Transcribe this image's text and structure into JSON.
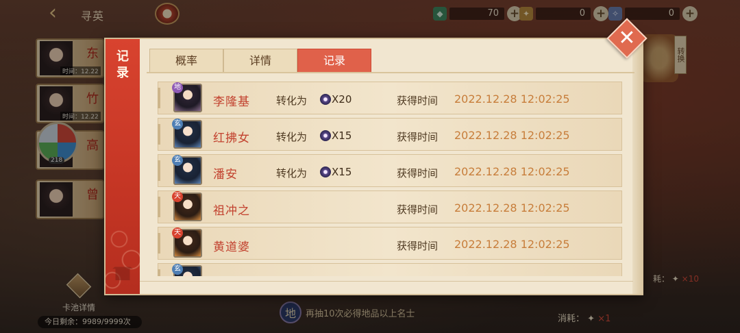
{
  "topbar": {
    "back_icon": "chevron-left-icon",
    "title": "寻英",
    "currencies": [
      {
        "icon": "jade-icon",
        "value": "70"
      },
      {
        "icon": "coin-icon",
        "value": "0"
      },
      {
        "icon": "gem-icon",
        "value": "0"
      }
    ]
  },
  "side_banners": [
    {
      "name": "东",
      "time": "时间：12.22"
    },
    {
      "name": "竹",
      "time": "时间：12.22"
    },
    {
      "name": "高",
      "time": ""
    },
    {
      "name": "曾",
      "time": ""
    }
  ],
  "zipper_badge": {
    "count": "218"
  },
  "pool_detail": {
    "label": "卡池详情",
    "remaining": "今日剩余：9989/9999次"
  },
  "bottom_hint": {
    "rank": "地",
    "text": "再抽10次必得地品以上名士"
  },
  "consume": {
    "label": "消耗：",
    "qty": "×1",
    "right_label": "耗：",
    "right_qty": "×10"
  },
  "right_tag": "转换",
  "modal": {
    "side_title": "记录",
    "tabs": [
      {
        "label": "概率",
        "active": false
      },
      {
        "label": "详情",
        "active": false
      },
      {
        "label": "记录",
        "active": true
      }
    ],
    "records": [
      {
        "rank": "地",
        "rank_color": "purple",
        "avatar": "purple",
        "name": "李隆基",
        "convert_label": "转化为",
        "convert_qty": "X20",
        "gain_label": "获得时间",
        "time": "2022.12.28  12:02:25"
      },
      {
        "rank": "玄",
        "rank_color": "blue",
        "avatar": "blue",
        "name": "红拂女",
        "convert_label": "转化为",
        "convert_qty": "X15",
        "gain_label": "获得时间",
        "time": "2022.12.28  12:02:25"
      },
      {
        "rank": "玄",
        "rank_color": "blue",
        "avatar": "blue",
        "name": "潘安",
        "convert_label": "转化为",
        "convert_qty": "X15",
        "gain_label": "获得时间",
        "time": "2022.12.28  12:02:25"
      },
      {
        "rank": "天",
        "rank_color": "red",
        "avatar": "orange",
        "name": "祖冲之",
        "convert_label": "",
        "convert_qty": "",
        "gain_label": "获得时间",
        "time": "2022.12.28  12:02:25"
      },
      {
        "rank": "天",
        "rank_color": "red",
        "avatar": "orange",
        "name": "黄道婆",
        "convert_label": "",
        "convert_qty": "",
        "gain_label": "获得时间",
        "time": "2022.12.28  12:02:25"
      },
      {
        "rank": "玄",
        "rank_color": "blue",
        "avatar": "blue",
        "name": "",
        "convert_label": "",
        "convert_qty": "",
        "gain_label": "",
        "time": ""
      }
    ],
    "close_icon": "close-icon"
  },
  "colors": {
    "accent_red": "#e0614a",
    "time_orange": "#c77d3a",
    "name_red": "#c2422f"
  }
}
